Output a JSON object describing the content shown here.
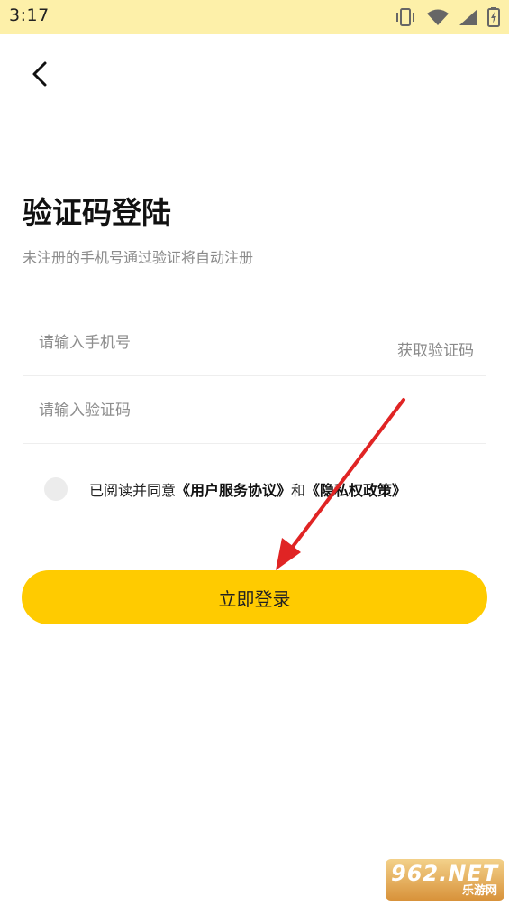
{
  "status_bar": {
    "time": "3:17",
    "icons": [
      "vibrate-icon",
      "wifi-icon",
      "signal-icon",
      "battery-icon"
    ]
  },
  "header": {
    "back_icon": "chevron-left-icon"
  },
  "title": "验证码登陆",
  "subtitle": "未注册的手机号通过验证将自动注册",
  "phone_field": {
    "placeholder": "请输入手机号",
    "value": "",
    "get_code_label": "获取验证码"
  },
  "code_field": {
    "placeholder": "请输入验证码",
    "value": ""
  },
  "agreement": {
    "checked": false,
    "prefix": "已阅读并同意",
    "user_agreement": "《用户服务协议》",
    "conjunction": "和",
    "privacy_policy": "《隐私权政策》"
  },
  "login_button_label": "立即登录",
  "colors": {
    "status_bar_bg": "#fdf0a9",
    "accent": "#ffcb00",
    "annotation_arrow": "#e02424"
  },
  "watermark": {
    "logo": "962.NET",
    "sub": "乐游网"
  }
}
